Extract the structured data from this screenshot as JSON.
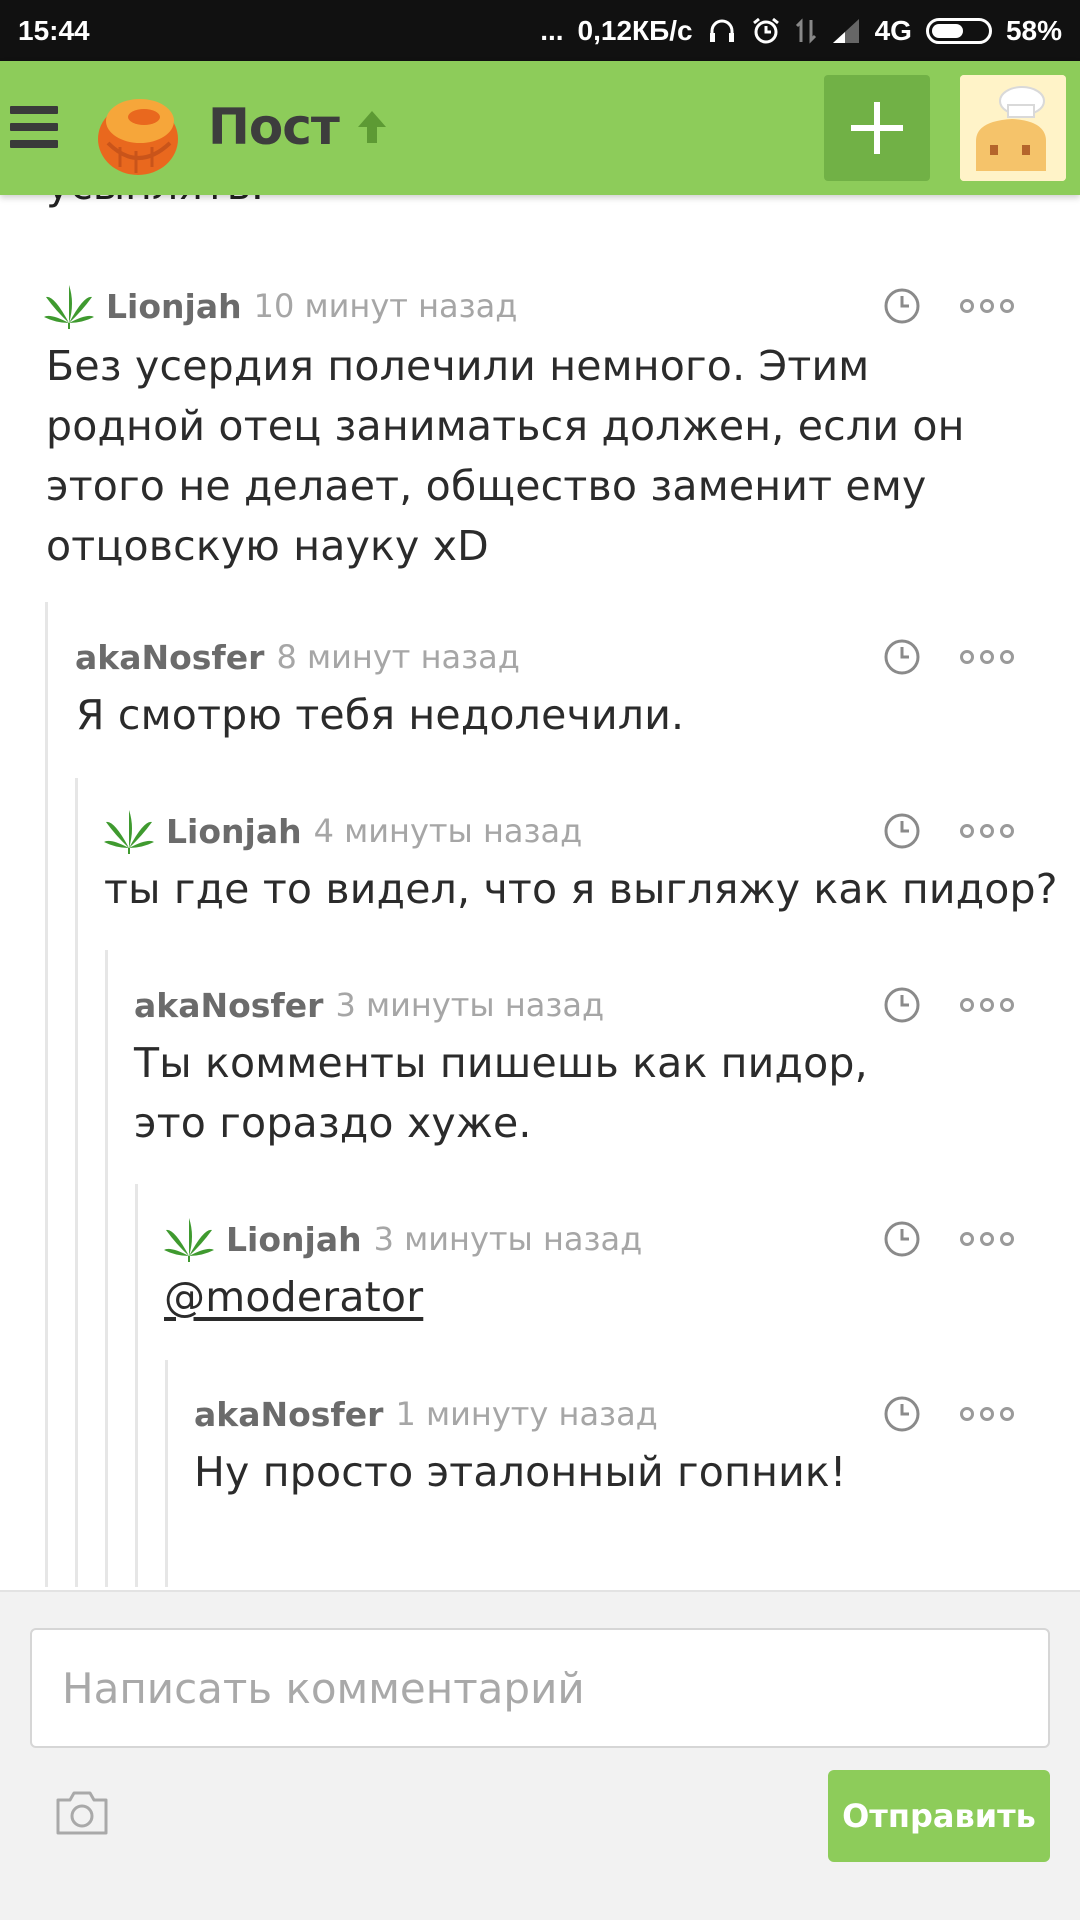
{
  "status_bar": {
    "time": "15:44",
    "dots": "...",
    "net_speed": "0,12КБ/с",
    "network": "4G",
    "battery": "58%",
    "battery_level": 0.58,
    "icons": [
      "headphones-icon",
      "alarm-icon",
      "data-arrows-icon",
      "signal-icon",
      "battery-icon"
    ]
  },
  "app_bar": {
    "title": "Пост",
    "menu_icon": "hamburger-icon",
    "logo_icon": "pikabu-logo",
    "title_icon": "arrow-up-icon",
    "add_icon": "plus-icon",
    "avatar_icon": "user-avatar",
    "color": "#8dcc5a",
    "add_color": "#71b146"
  },
  "partial_text": "усыплять.",
  "comments": [
    {
      "user": "Lionjah",
      "time": "10 минут назад",
      "text": "Без усердия полечили немного. Этим родной отец заниматься должен, если он этого не делает, общество заменит ему отцовскую науку xD",
      "has_badge": true,
      "depth": 0
    },
    {
      "user": "akaNosfer",
      "time": "8 минут назад",
      "text": "Я смотрю тебя недолечили.",
      "has_badge": false,
      "depth": 1
    },
    {
      "user": "Lionjah",
      "time": "4 минуты назад",
      "text": "ты где то видел, что я выгляжу как пидор?",
      "has_badge": true,
      "depth": 2
    },
    {
      "user": "akaNosfer",
      "time": "3 минуты назад",
      "text": "Ты комменты пишешь как пидор, это гораздо хуже.",
      "has_badge": false,
      "depth": 3
    },
    {
      "user": "Lionjah",
      "time": "3 минуты назад",
      "text": "@moderator",
      "has_badge": true,
      "depth": 4
    },
    {
      "user": "akaNosfer",
      "time": "1 минуту назад",
      "text": "Ну просто эталонный гопник!",
      "has_badge": false,
      "depth": 5
    }
  ],
  "comment_icons": {
    "time": "clock-icon",
    "more": "more-dots-icon",
    "badge": "leaf-icon"
  },
  "composer": {
    "placeholder": "Написать комментарий",
    "value": "",
    "send_label": "Отправить",
    "camera_icon": "camera-icon",
    "send_color": "#8dcc5a"
  }
}
